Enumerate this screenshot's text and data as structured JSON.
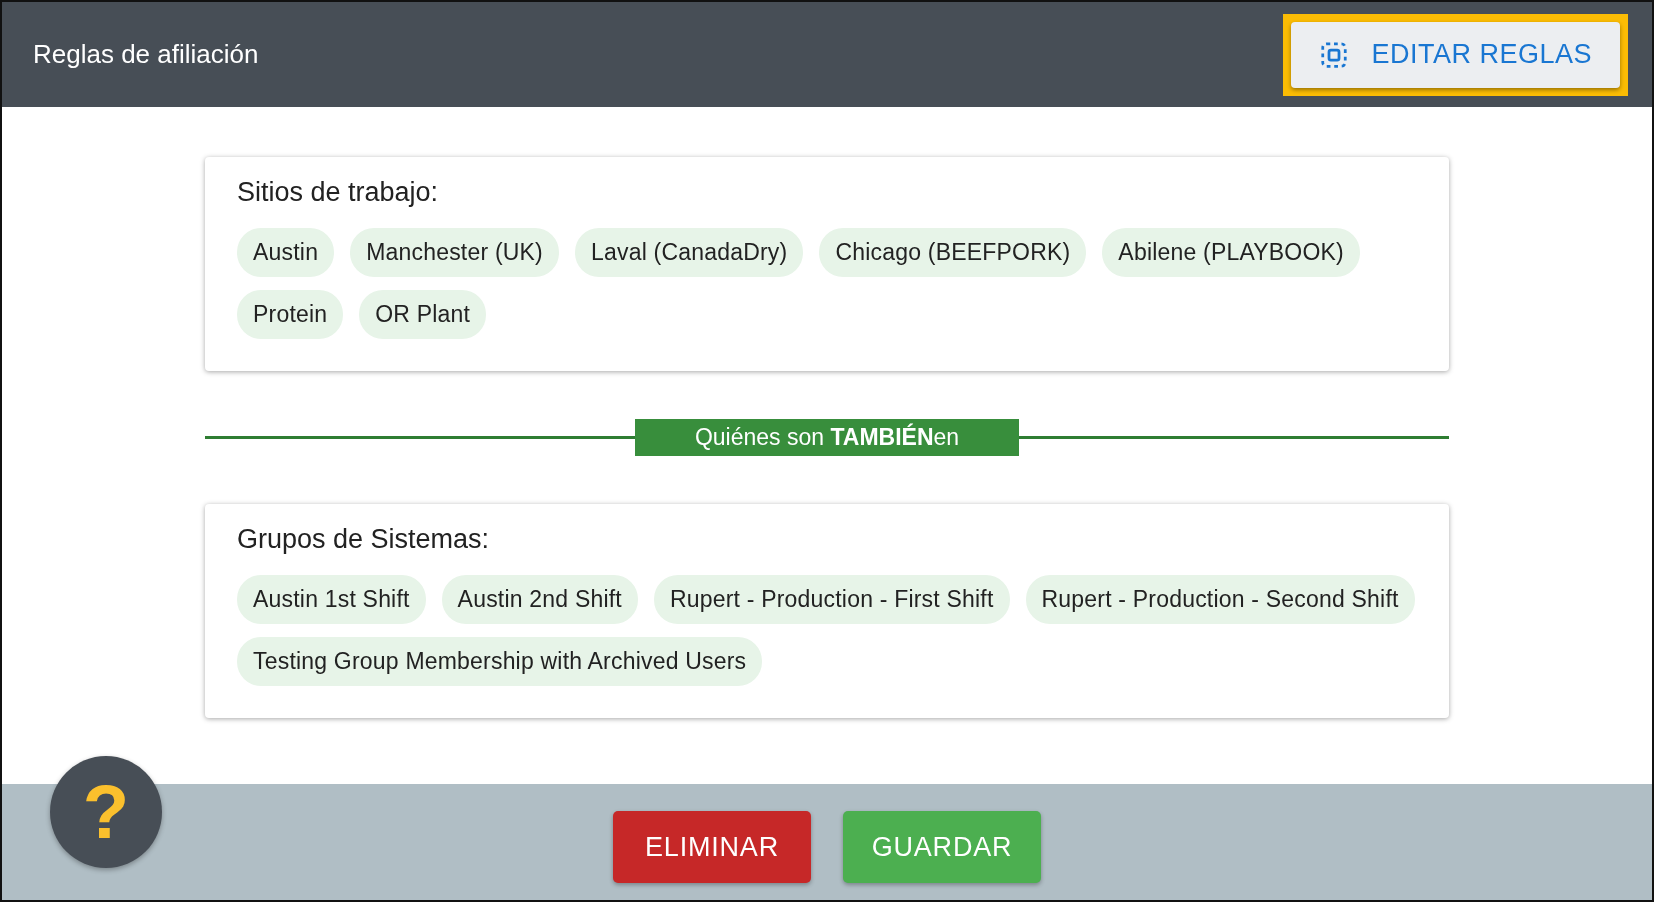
{
  "header": {
    "title": "Reglas de afiliación",
    "edit_button": {
      "label": "EDITAR REGLAS",
      "highlighted": true
    }
  },
  "sections": [
    {
      "title": "Sitios de trabajo:",
      "chips": [
        "Austin",
        "Manchester (UK)",
        "Laval (CanadaDry)",
        "Chicago (BEEFPORK)",
        "Abilene (PLAYBOOK)",
        "Protein",
        "OR Plant"
      ]
    },
    {
      "title": "Grupos de Sistemas:",
      "chips": [
        "Austin 1st Shift",
        "Austin 2nd Shift",
        "Rupert - Production - First Shift",
        "Rupert - Production - Second Shift",
        "Testing Group Membership with Archived Users"
      ]
    }
  ],
  "divider": {
    "label": "Quiénes son **TAMBIÉN**en"
  },
  "help_button": {
    "label": "?"
  },
  "footer": {
    "buttons": [
      {
        "label": "ELIMINAR",
        "kind": "danger"
      },
      {
        "label": "GUARDAR",
        "kind": "primary"
      }
    ]
  }
}
